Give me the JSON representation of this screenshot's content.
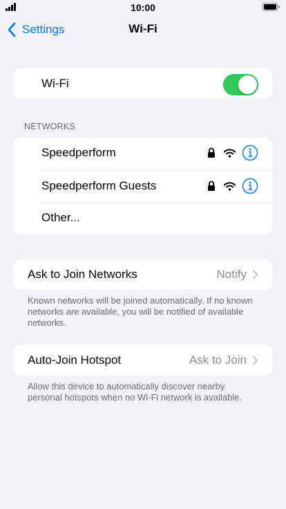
{
  "status_bar": {
    "time": "10:00",
    "signal_icon": "cellular-signal-icon",
    "battery_icon": "battery-icon"
  },
  "nav": {
    "back_label": "Settings",
    "title": "Wi-Fi"
  },
  "wifi": {
    "label": "Wi-Fi",
    "enabled": true
  },
  "networks": {
    "header": "NETWORKS",
    "items": [
      {
        "name": "Speedperform",
        "secured": true
      },
      {
        "name": "Speedperform Guests",
        "secured": true
      },
      {
        "name": "Other..."
      }
    ]
  },
  "ask_to_join": {
    "label": "Ask to Join Networks",
    "value": "Notify",
    "footer": "Known networks will be joined automatically. If no known networks are available, you will be notified of available networks."
  },
  "auto_join": {
    "label": "Auto-Join Hotspot",
    "value": "Ask to Join",
    "footer": "Allow this device to automatically discover nearby personal hotspots when no Wi-Fi network is available."
  },
  "colors": {
    "accent": "#007aff",
    "toggle_on": "#34c759",
    "background": "#f2f2f7",
    "secondary_text": "#8e8e93"
  }
}
